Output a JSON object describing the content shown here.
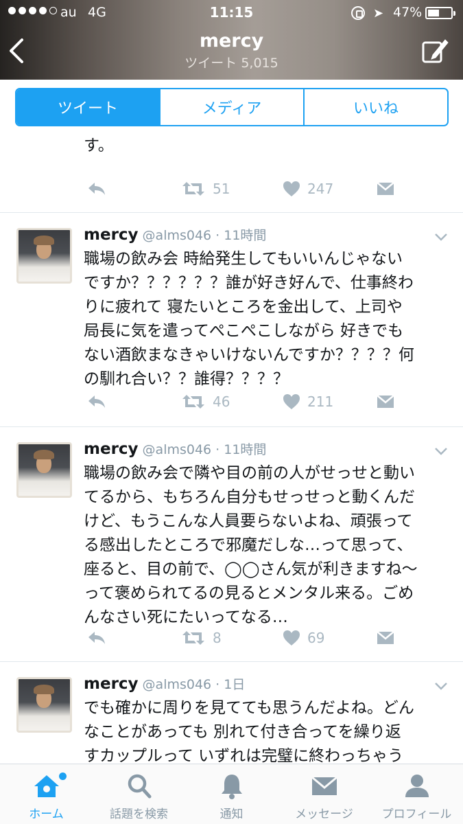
{
  "status": {
    "carrier": "au",
    "network": "4G",
    "time": "11:15",
    "battery": "47%"
  },
  "nav": {
    "title": "mercy",
    "subtitle": "ツイート 5,015"
  },
  "tabs": [
    "ツイート",
    "メディア",
    "いいね"
  ],
  "tweets": [
    {
      "text": "い！！！って全力でなりませんか！？私はなりま\nす。",
      "retweets": "51",
      "likes": "247"
    },
    {
      "name": "mercy",
      "meta": "@alms046 · 11時間",
      "text": "職場の飲み会 時給発生してもいいんじゃない\nですか？？？？？？誰が好き好んで、仕事終わ\nりに疲れて 寝たいところを金出して、上司や\n局長に気を遣ってぺこぺこしながら 好きでも\nない酒飲まなきゃいけないんですか？？？？何\nの馴れ合い？？誰得？？？？",
      "retweets": "46",
      "likes": "211"
    },
    {
      "name": "mercy",
      "meta": "@alms046 · 11時間",
      "text": "職場の飲み会で隣や目の前の人がせっせと動い\nてるから、もちろん自分もせっせっと動くんだ\nけど、もうこんな人員要らないよね、頑張って\nる感出したところで邪魔だしな…って思って、\n座ると、目の前で、◯◯さん気が利きますね〜\nって褒められてるの見るとメンタル来る。ごめ\nんなさい死にたいってなる…",
      "retweets": "8",
      "likes": "69"
    },
    {
      "name": "mercy",
      "meta": "@alms046 · 1日",
      "text": "でも確かに周りを見てても思うんだよね。どん\nなことがあっても 別れて付き合ってを繰り返\nすカップルって いずれは完璧に終わっちゃう"
    }
  ],
  "tabbar": [
    "ホーム",
    "話題を検索",
    "通知",
    "メッセージ",
    "プロフィール"
  ],
  "icons": [
    "back-arrow-icon",
    "compose-icon",
    "reply-icon",
    "retweet-icon",
    "heart-icon",
    "dm-icon",
    "home-icon",
    "search-icon",
    "bell-icon",
    "envelope-icon",
    "person-icon"
  ],
  "colors": {
    "accent": "#1da1f2",
    "muted": "#8899a6",
    "actionGray": "#aab8c2"
  }
}
